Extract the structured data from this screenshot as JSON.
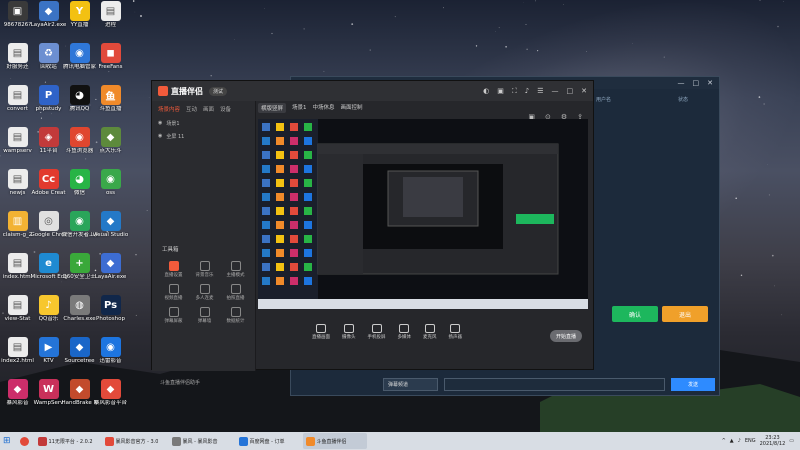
{
  "desktop": {
    "icons": [
      {
        "label": "9867826?",
        "color": "#3a3a3a",
        "glyph": "▣"
      },
      {
        "label": "LayaAir2.exe",
        "color": "#3b73c4",
        "glyph": "◆"
      },
      {
        "label": "YY直播",
        "color": "#f3c112",
        "glyph": "Y"
      },
      {
        "label": "进程",
        "color": "#ececec",
        "glyph": "▤"
      },
      {
        "label": "好服务还",
        "color": "#ececec",
        "glyph": "▤"
      },
      {
        "label": "回收站",
        "color": "#6c8fd1",
        "glyph": "♻"
      },
      {
        "label": "腾讯电脑管家",
        "color": "#2f77d8",
        "glyph": "◉"
      },
      {
        "label": "FreeFans",
        "color": "#e14a3b",
        "glyph": "◼"
      },
      {
        "label": "convert",
        "color": "#ececec",
        "glyph": "▤"
      },
      {
        "label": "phpstudy",
        "color": "#2f63c8",
        "glyph": "P"
      },
      {
        "label": "腾讯QQ",
        "color": "#111",
        "glyph": "◕"
      },
      {
        "label": "斗鱼直播",
        "color": "#f08a2a",
        "glyph": "鱼"
      },
      {
        "label": "wampserv",
        "color": "#ececec",
        "glyph": "▤"
      },
      {
        "label": "11平台",
        "color": "#c23a3a",
        "glyph": "◈"
      },
      {
        "label": "斗鱼浏览器",
        "color": "#e0462f",
        "glyph": "◉"
      },
      {
        "label": "点大乐斗",
        "color": "#5d8a3c",
        "glyph": "◆"
      },
      {
        "label": "newjs",
        "color": "#ececec",
        "glyph": "▤"
      },
      {
        "label": "Adobe Creat",
        "color": "#e23a2e",
        "glyph": "Cc"
      },
      {
        "label": "微信",
        "color": "#28b446",
        "glyph": "◕"
      },
      {
        "label": "oss",
        "color": "#3aa84a",
        "glyph": "◉"
      },
      {
        "label": "claism-g_2",
        "color": "#f2b233",
        "glyph": "▥"
      },
      {
        "label": "Google Chrome",
        "color": "#e0e0e0",
        "glyph": "◎"
      },
      {
        "label": "微信开发者工具",
        "color": "#2aa55a",
        "glyph": "◉"
      },
      {
        "label": "Visual Studio Code",
        "color": "#2479c7",
        "glyph": "◆"
      },
      {
        "label": "index.html",
        "color": "#ececec",
        "glyph": "▤"
      },
      {
        "label": "Microsoft Edge",
        "color": "#1f8ad1",
        "glyph": "e"
      },
      {
        "label": "360安全卫士",
        "color": "#3aa83a",
        "glyph": "+"
      },
      {
        "label": "LayaAir.exe",
        "color": "#3d6dd2",
        "glyph": "◆"
      },
      {
        "label": "view-Stat",
        "color": "#ececec",
        "glyph": "▤"
      },
      {
        "label": "QQ音乐",
        "color": "#f7c72e",
        "glyph": "♪"
      },
      {
        "label": "Charles.exe",
        "color": "#7a7a7a",
        "glyph": "◍"
      },
      {
        "label": "Photoshop",
        "color": "#11274a",
        "glyph": "Ps"
      },
      {
        "label": "index2.html",
        "color": "#ececec",
        "glyph": "▤"
      },
      {
        "label": "KTV",
        "color": "#2474d8",
        "glyph": "▶"
      },
      {
        "label": "Sourcetree",
        "color": "#1a66c8",
        "glyph": "◆"
      },
      {
        "label": "迅雷影音",
        "color": "#1d75e0",
        "glyph": "◉"
      },
      {
        "label": "暴风影音",
        "color": "#cc2e6a",
        "glyph": "◆"
      },
      {
        "label": "WampServ",
        "color": "#c9305a",
        "glyph": "W"
      },
      {
        "label": "HandBrake Nightly",
        "color": "#c24b2c",
        "glyph": "◆"
      },
      {
        "label": "暴风影音平台",
        "color": "#e24a3a",
        "glyph": "◆"
      }
    ]
  },
  "backwin": {
    "title_controls": [
      "—",
      "□",
      "✕"
    ],
    "col_headers": [
      "用户名",
      "状态"
    ],
    "buttons": [
      {
        "label": "确认",
        "color": "#1db75d"
      },
      {
        "label": "退出",
        "color": "#f0a02a"
      }
    ],
    "chat": {
      "select": "弹幕频道",
      "send": "发送",
      "status": "0 开关"
    }
  },
  "mainwin": {
    "logo": "直播伴侣",
    "badge": "测试",
    "controls": [
      "◐",
      "▣",
      "⛶",
      "♪",
      "☰",
      "—",
      "□",
      "✕"
    ],
    "tabs": [
      "场景内容",
      "互动",
      "画面",
      "设备"
    ],
    "scene": {
      "name": "场景1",
      "item": "全屏 11"
    },
    "top_tabs": [
      "横版竖屏",
      "场景1",
      "中场休息",
      "画面控制"
    ],
    "tool_title": "工具箱",
    "tools": [
      "直播设置",
      "背景音乐",
      "主播模式",
      "视频直播",
      "多人连麦",
      "拍照直播",
      "弹幕屏蔽",
      "弹幕墙",
      "数据统计"
    ],
    "bottom_label": "斗鱼直播伴侣助手",
    "controlbar": [
      "直播画面",
      "摄像头",
      "手机投屏",
      "多媒体",
      "麦克风",
      "扬声器"
    ],
    "live_label": "开始直播"
  },
  "taskbar": {
    "items": [
      {
        "label": "11无限平台 - 2.0.2",
        "color": "#c23a3a"
      },
      {
        "label": "暴风影音官方 - 3.0",
        "color": "#e24a3a"
      },
      {
        "label": "暴风 - 暴风影音",
        "color": "#7a7a7a"
      },
      {
        "label": "百度网盘 - 订单",
        "color": "#2474d8"
      },
      {
        "label": "斗鱼直播伴侣",
        "color": "#f08a2a"
      }
    ],
    "tray_lang": "ENG",
    "time": "23:23",
    "date": "2021/8/12"
  }
}
